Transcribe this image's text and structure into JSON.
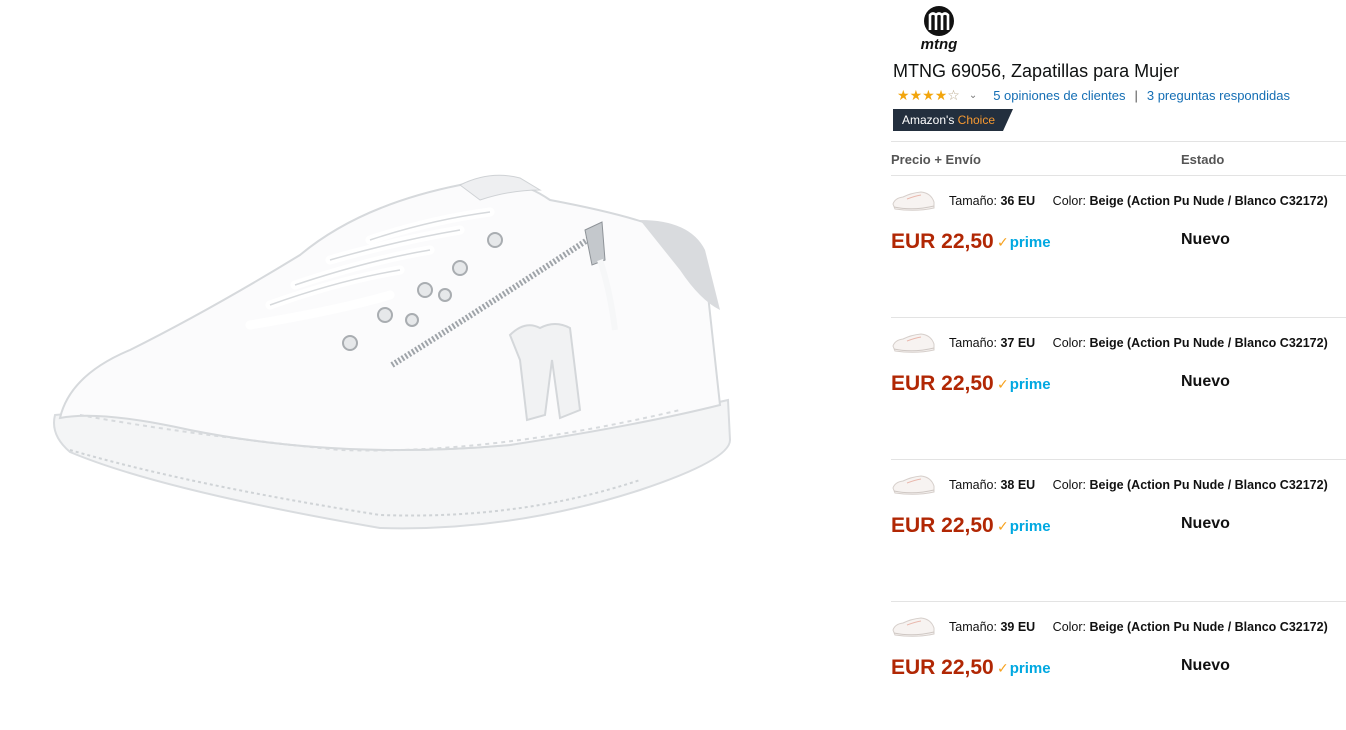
{
  "brand": {
    "logo_text": "mtng"
  },
  "product": {
    "title": "MTNG 69056, Zapatillas para Mujer",
    "rating": {
      "value": 4,
      "max": 5
    },
    "reviews_link": "5 opiniones de clientes",
    "questions_link": "3 preguntas respondidas",
    "separator": "|",
    "badge": {
      "prefix": "Amazon's",
      "accent": "Choice"
    }
  },
  "table": {
    "headers": {
      "price": "Precio + Envío",
      "condition": "Estado"
    }
  },
  "offers": [
    {
      "size_label": "Tamaño:",
      "size": "36 EU",
      "color_label": "Color:",
      "color": "Beige (Action Pu Nude / Blanco C32172)",
      "price": "EUR 22,50",
      "prime": "prime",
      "condition": "Nuevo"
    },
    {
      "size_label": "Tamaño:",
      "size": "37 EU",
      "color_label": "Color:",
      "color": "Beige (Action Pu Nude / Blanco C32172)",
      "price": "EUR 22,50",
      "prime": "prime",
      "condition": "Nuevo"
    },
    {
      "size_label": "Tamaño:",
      "size": "38 EU",
      "color_label": "Color:",
      "color": "Beige (Action Pu Nude / Blanco C32172)",
      "price": "EUR 22,50",
      "prime": "prime",
      "condition": "Nuevo"
    },
    {
      "size_label": "Tamaño:",
      "size": "39 EU",
      "color_label": "Color:",
      "color": "Beige (Action Pu Nude / Blanco C32172)",
      "price": "EUR 22,50",
      "prime": "prime",
      "condition": "Nuevo"
    }
  ],
  "colors": {
    "price": "#b12704",
    "link": "#146eb4",
    "prime": "#00a8e1",
    "star": "#f2a50c",
    "badge_bg": "#232f3e",
    "badge_accent": "#f69931"
  },
  "icons": {
    "logo": "mtng-logo-icon",
    "star": "star-icon",
    "chevron": "chevron-down-icon",
    "prime_check": "prime-check-icon"
  }
}
